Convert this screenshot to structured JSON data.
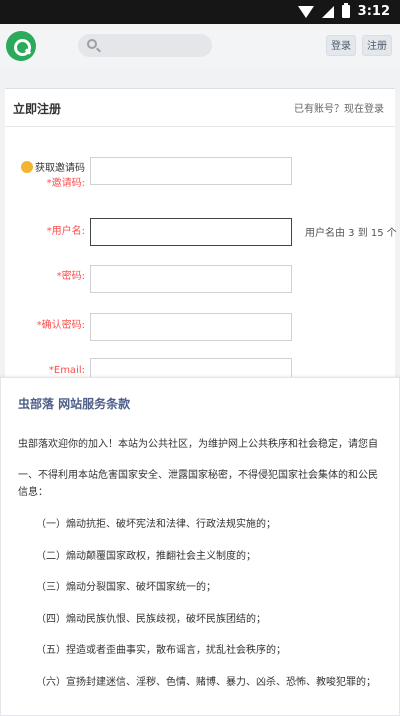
{
  "status_bar": {
    "time": "3:12"
  },
  "header": {
    "login_label": "登录",
    "register_label": "注册"
  },
  "register": {
    "title": "立即注册",
    "login_link": "已有账号？现在登录",
    "invite_link_label": "获取邀请码",
    "invite_label": "*邀请码:",
    "username_label": "*用户名:",
    "username_hint": "用户名由 3 到 15 个",
    "password_label": "*密码:",
    "confirm_label": "*确认密码:",
    "email_label": "*Email:"
  },
  "terms": {
    "title": "虫部落 网站服务条款",
    "intro": "虫部落欢迎你的加入！本站为公共社区，为维护网上公共秩序和社会稳定，请您自",
    "rule1_line1": "一、不得利用本站危害国家安全、泄露国家秘密，不得侵犯国家社会集体的和公民",
    "rule1_line2": "信息：",
    "items": [
      "（一）煽动抗拒、破坏宪法和法律、行政法规实施的；",
      "（二）煽动颠覆国家政权，推翻社会主义制度的；",
      "（三）煽动分裂国家、破坏国家统一的；",
      "（四）煽动民族仇恨、民族歧视，破坏民族团结的；",
      "（五）捏造或者歪曲事实，散布谣言，扰乱社会秩序的；",
      "（六）宣扬封建迷信、淫秽、色情、赌博、暴力、凶杀、恐怖、教唆犯罪的；"
    ]
  }
}
